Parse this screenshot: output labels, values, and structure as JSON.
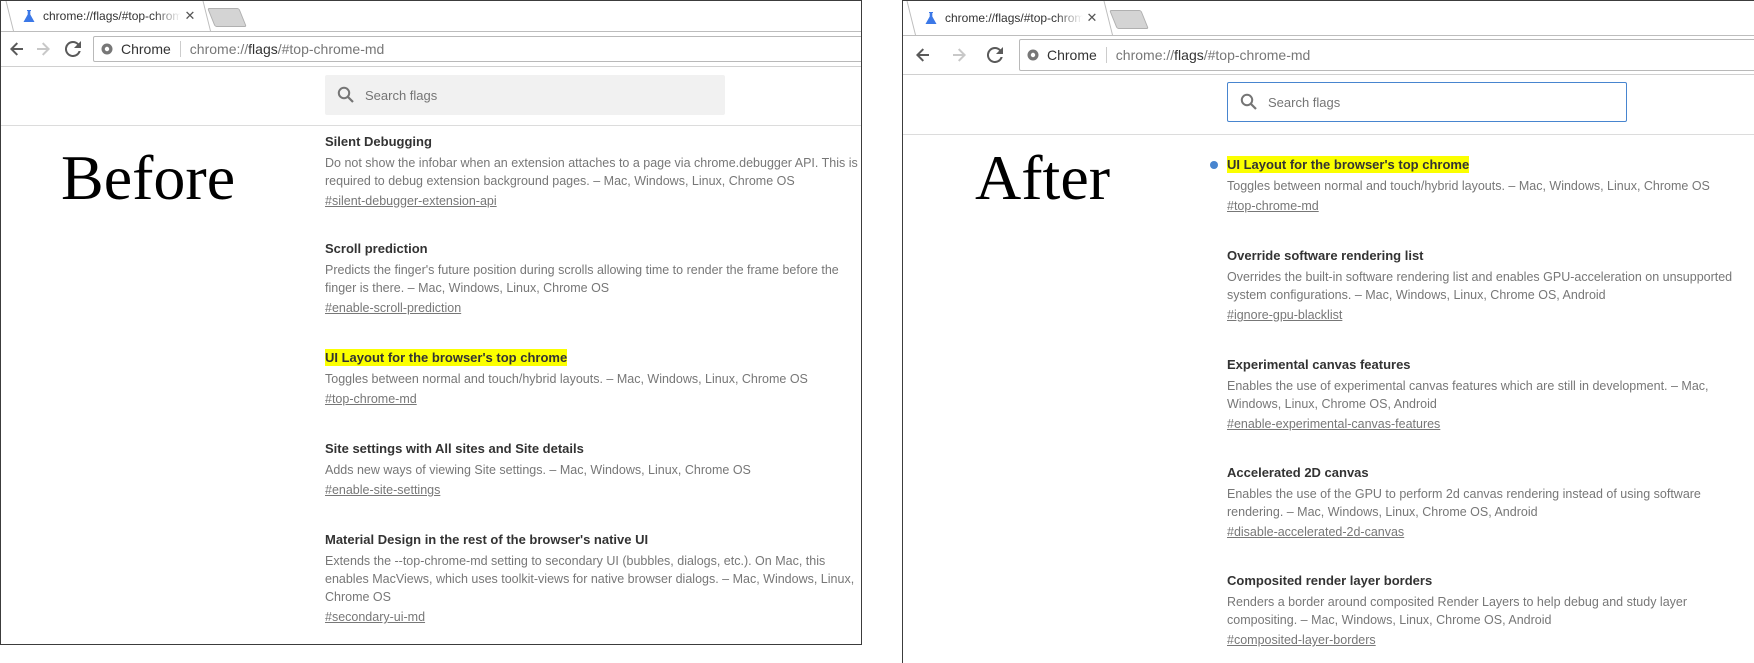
{
  "accent_color": "#4885cf",
  "highlight_color": "#fbff00",
  "before": {
    "label": "Before",
    "tab_title": "chrome://flags/#top-chrome-md",
    "chip": "Chrome",
    "url_prefix": "chrome://",
    "url_host": "flags",
    "url_suffix": "/#top-chrome-md",
    "search_placeholder": "Search flags",
    "flags": [
      {
        "title": "Silent Debugging",
        "desc": "Do not show the infobar when an extension attaches to a page via chrome.debugger API. This is required to debug extension background pages. – Mac, Windows, Linux, Chrome OS",
        "link": "#silent-debugger-extension-api",
        "highlighted": false
      },
      {
        "title": "Scroll prediction",
        "desc": "Predicts the finger's future position during scrolls allowing time to render the frame before the finger is there. – Mac, Windows, Linux, Chrome OS",
        "link": "#enable-scroll-prediction",
        "highlighted": false
      },
      {
        "title": "UI Layout for the browser's top chrome",
        "desc": "Toggles between normal and touch/hybrid layouts. – Mac, Windows, Linux, Chrome OS",
        "link": "#top-chrome-md",
        "highlighted": true
      },
      {
        "title": "Site settings with All sites and Site details",
        "desc": "Adds new ways of viewing Site settings. – Mac, Windows, Linux, Chrome OS",
        "link": "#enable-site-settings",
        "highlighted": false
      },
      {
        "title": "Material Design in the rest of the browser's native UI",
        "desc": "Extends the --top-chrome-md setting to secondary UI (bubbles, dialogs, etc.). On Mac, this enables MacViews, which uses toolkit-views for native browser dialogs. – Mac, Windows, Linux, Chrome OS",
        "link": "#secondary-ui-md",
        "highlighted": false
      }
    ]
  },
  "after": {
    "label": "After",
    "tab_title": "chrome://flags/#top-chrome-md",
    "chip": "Chrome",
    "url_prefix": "chrome://",
    "url_host": "flags",
    "url_suffix": "/#top-chrome-md",
    "search_placeholder": "Search flags",
    "flags": [
      {
        "title": "UI Layout for the browser's top chrome",
        "desc": "Toggles between normal and touch/hybrid layouts. – Mac, Windows, Linux, Chrome OS",
        "link": "#top-chrome-md",
        "highlighted": true,
        "modified_dot": true
      },
      {
        "title": "Override software rendering list",
        "desc": "Overrides the built-in software rendering list and enables GPU-acceleration on unsupported system configurations. – Mac, Windows, Linux, Chrome OS, Android",
        "link": "#ignore-gpu-blacklist",
        "highlighted": false
      },
      {
        "title": "Experimental canvas features",
        "desc": "Enables the use of experimental canvas features which are still in development. – Mac, Windows, Linux, Chrome OS, Android",
        "link": "#enable-experimental-canvas-features",
        "highlighted": false
      },
      {
        "title": "Accelerated 2D canvas",
        "desc": "Enables the use of the GPU to perform 2d canvas rendering instead of using software rendering. – Mac, Windows, Linux, Chrome OS, Android",
        "link": "#disable-accelerated-2d-canvas",
        "highlighted": false
      },
      {
        "title": "Composited render layer borders",
        "desc": "Renders a border around composited Render Layers to help debug and study layer compositing. – Mac, Windows, Linux, Chrome OS, Android",
        "link": "#composited-layer-borders",
        "highlighted": false
      }
    ]
  }
}
